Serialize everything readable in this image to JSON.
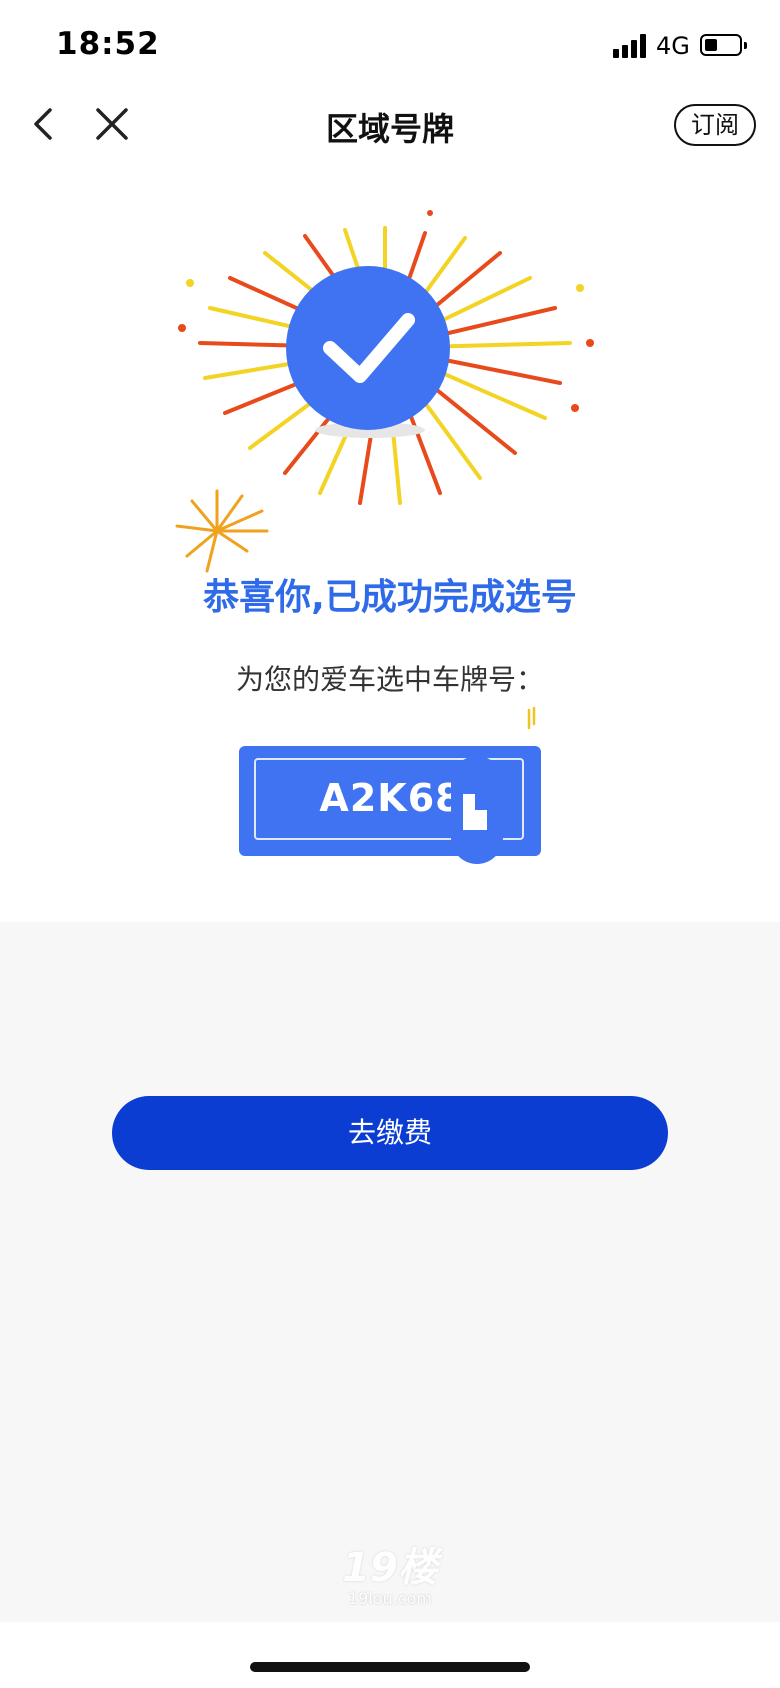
{
  "status_bar": {
    "time": "18:52",
    "network": "4G",
    "battery_level": 0.35
  },
  "nav": {
    "title": "区域号牌",
    "subscribe_label": "订阅"
  },
  "success": {
    "heading": "恭喜你,已成功完成选号",
    "subtitle": "为您的爱车选中车牌号：",
    "plate_number": "A2K68",
    "plate_color": "#3f73f1",
    "accent_color": "#2f6ae8"
  },
  "actions": {
    "pay_label": "去缴费",
    "pay_color": "#0c3dd3"
  },
  "watermark": {
    "logo": "19楼",
    "site": "19lou.com"
  }
}
